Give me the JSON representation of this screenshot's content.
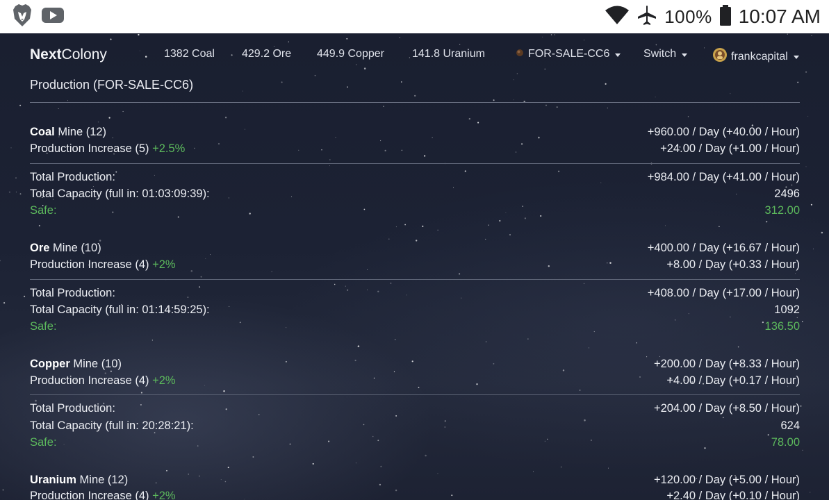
{
  "status_bar": {
    "icons": [
      "brave-lion-icon",
      "youtube-icon",
      "wifi-icon",
      "airplane-mode-icon",
      "battery-icon"
    ],
    "battery": "100%",
    "time": "10:07 AM"
  },
  "navbar": {
    "brand_bold": "Next",
    "brand_light": "Colony",
    "resources": [
      "1382 Coal",
      "429.2 Ore",
      "449.9 Copper",
      "141.8 Uranium"
    ],
    "planet": "FOR-SALE-CC6",
    "switch": "Switch",
    "user": "frankcapital"
  },
  "page": {
    "title": "Production (FOR-SALE-CC6)"
  },
  "production": [
    {
      "resource": "Coal",
      "mine_label": "Mine (12)",
      "mine_rate": "+960.00 / Day (+40.00 / Hour)",
      "increase_label": "Production Increase (5)",
      "increase_pct": "+2.5%",
      "increase_rate": "+24.00 / Day (+1.00 / Hour)",
      "total_label": "Total Production:",
      "total_rate": "+984.00 / Day (+41.00 / Hour)",
      "capacity_label": "Total Capacity (full in: 01:03:09:39):",
      "capacity": "2496",
      "safe_label": "Safe:",
      "safe": "312.00"
    },
    {
      "resource": "Ore",
      "mine_label": "Mine (10)",
      "mine_rate": "+400.00 / Day (+16.67 / Hour)",
      "increase_label": "Production Increase (4)",
      "increase_pct": "+2%",
      "increase_rate": "+8.00 / Day (+0.33 / Hour)",
      "total_label": "Total Production:",
      "total_rate": "+408.00 / Day (+17.00 / Hour)",
      "capacity_label": "Total Capacity (full in: 01:14:59:25):",
      "capacity": "1092",
      "safe_label": "Safe:",
      "safe": "136.50"
    },
    {
      "resource": "Copper",
      "mine_label": "Mine (10)",
      "mine_rate": "+200.00 / Day (+8.33 / Hour)",
      "increase_label": "Production Increase (4)",
      "increase_pct": "+2%",
      "increase_rate": "+4.00 / Day (+0.17 / Hour)",
      "total_label": "Total Production:",
      "total_rate": "+204.00 / Day (+8.50 / Hour)",
      "capacity_label": "Total Capacity (full in: 20:28:21):",
      "capacity": "624",
      "safe_label": "Safe:",
      "safe": "78.00"
    },
    {
      "resource": "Uranium",
      "mine_label": "Mine (12)",
      "mine_rate": "+120.00 / Day (+5.00 / Hour)",
      "increase_label": "Production Increase (4)",
      "increase_pct": "+2%",
      "increase_rate": "+2.40 / Day (+0.10 / Hour)"
    }
  ],
  "colors": {
    "accent_green": "#5cb85c",
    "background": "#1b2031",
    "status_bar": "#ffffff"
  }
}
